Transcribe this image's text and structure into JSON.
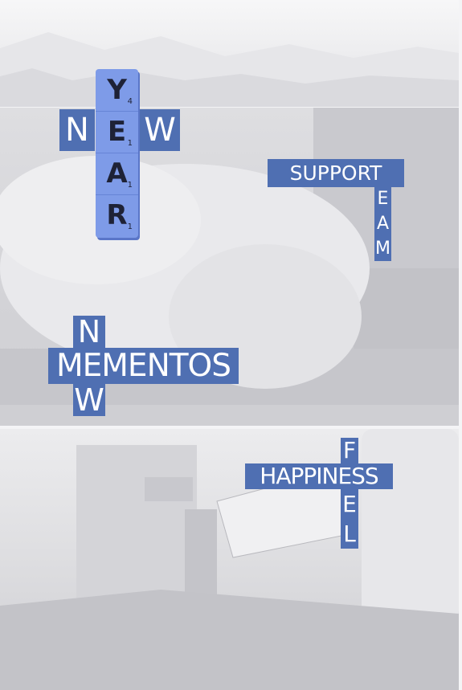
{
  "puzzle_1": {
    "vertical_letters": [
      "Y",
      "E",
      "A",
      "R"
    ],
    "letter_scores": [
      "4",
      "1",
      "1",
      "1"
    ],
    "across_left": "N",
    "across_right": "W"
  },
  "puzzle_2": {
    "across_word": "SUPPORT",
    "down_letters": [
      "E",
      "A",
      "M"
    ]
  },
  "puzzle_3": {
    "down_top": "N",
    "across_word": "MEMENTOS",
    "down_bottom": "W"
  },
  "puzzle_4": {
    "down_top": "F",
    "across_word": "HAPPINESS",
    "down_bottom": [
      "E",
      "L"
    ]
  },
  "colors": {
    "tile": "#4f6fb2",
    "scrabble_tile": "#7e9be8",
    "background": "#f4f4f6"
  }
}
